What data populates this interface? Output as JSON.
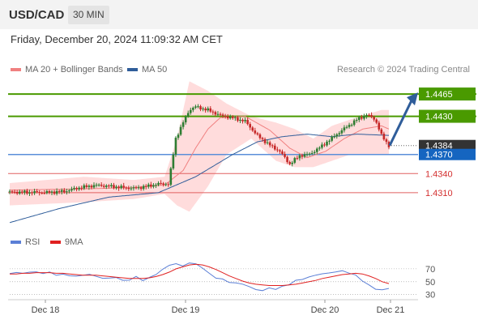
{
  "header": {
    "symbol": "USD/CAD",
    "timeframe": "30 MIN"
  },
  "datetime": "Friday, December 20, 2024 11:09:32 AM CET",
  "legend": [
    {
      "label": "MA 20 + Bollinger Bands",
      "color": "#f08080"
    },
    {
      "label": "MA 50",
      "color": "#2f5d9a"
    }
  ],
  "research_label": "Research © 2024 Trading Central",
  "colors": {
    "up": "#2e7d32",
    "down": "#c62828",
    "resistance": "#4a9a00",
    "support": "#e06060",
    "pivot": "#5b8fd9",
    "arrow": "#2f5d9a",
    "band": "#ffd6d6"
  },
  "chart_data": [
    {
      "type": "line",
      "title": "",
      "ylim": [
        1.425,
        1.4488
      ],
      "x_ticks": [
        "Dec 18",
        "Dec 19",
        "Dec 20",
        "Dec 21"
      ],
      "price_levels": [
        {
          "label": "1.4465",
          "value": 1.4465,
          "kind": "resistance"
        },
        {
          "label": "1.4430",
          "value": 1.443,
          "kind": "resistance"
        },
        {
          "label": "1.4384",
          "value": 1.4384,
          "kind": "current"
        },
        {
          "label": "1.4370",
          "value": 1.437,
          "kind": "pivot"
        },
        {
          "label": "1.4340",
          "value": 1.434,
          "kind": "support"
        },
        {
          "label": "1.4310",
          "value": 1.431,
          "kind": "support"
        }
      ],
      "close_key": [
        [
          0,
          1.4311
        ],
        [
          30,
          1.4311
        ],
        [
          45,
          1.4313
        ],
        [
          55,
          1.4318
        ],
        [
          70,
          1.4322
        ],
        [
          80,
          1.432
        ],
        [
          90,
          1.4318
        ],
        [
          100,
          1.4316
        ],
        [
          110,
          1.4319
        ],
        [
          120,
          1.4323
        ],
        [
          128,
          1.4323
        ],
        [
          130,
          1.4345
        ],
        [
          134,
          1.4395
        ],
        [
          140,
          1.442
        ],
        [
          145,
          1.444
        ],
        [
          150,
          1.4445
        ],
        [
          160,
          1.444
        ],
        [
          170,
          1.4432
        ],
        [
          180,
          1.4428
        ],
        [
          190,
          1.4423
        ],
        [
          200,
          1.44
        ],
        [
          210,
          1.4385
        ],
        [
          218,
          1.4375
        ],
        [
          226,
          1.4355
        ],
        [
          234,
          1.4368
        ],
        [
          242,
          1.437
        ],
        [
          250,
          1.438
        ],
        [
          260,
          1.4395
        ],
        [
          270,
          1.441
        ],
        [
          280,
          1.4424
        ],
        [
          288,
          1.4432
        ],
        [
          295,
          1.4425
        ],
        [
          300,
          1.44
        ],
        [
          306,
          1.4384
        ]
      ],
      "ma20_key": [
        [
          0,
          1.4314
        ],
        [
          60,
          1.4316
        ],
        [
          100,
          1.4318
        ],
        [
          125,
          1.4322
        ],
        [
          140,
          1.4345
        ],
        [
          150,
          1.438
        ],
        [
          160,
          1.441
        ],
        [
          170,
          1.4428
        ],
        [
          190,
          1.443
        ],
        [
          210,
          1.4408
        ],
        [
          226,
          1.438
        ],
        [
          240,
          1.4365
        ],
        [
          255,
          1.4375
        ],
        [
          270,
          1.4395
        ],
        [
          285,
          1.441
        ],
        [
          300,
          1.4415
        ],
        [
          306,
          1.441
        ]
      ],
      "ma50_key": [
        [
          0,
          1.4263
        ],
        [
          40,
          1.4285
        ],
        [
          80,
          1.4303
        ],
        [
          120,
          1.431
        ],
        [
          150,
          1.4335
        ],
        [
          180,
          1.437
        ],
        [
          200,
          1.439
        ],
        [
          220,
          1.4398
        ],
        [
          240,
          1.4402
        ],
        [
          260,
          1.4398
        ],
        [
          280,
          1.4402
        ],
        [
          306,
          1.44
        ]
      ],
      "bb_upper_key": [
        [
          0,
          1.4325
        ],
        [
          60,
          1.4335
        ],
        [
          100,
          1.433
        ],
        [
          125,
          1.4335
        ],
        [
          135,
          1.4395
        ],
        [
          145,
          1.4485
        ],
        [
          160,
          1.447
        ],
        [
          175,
          1.445
        ],
        [
          195,
          1.443
        ],
        [
          215,
          1.442
        ],
        [
          230,
          1.441
        ],
        [
          245,
          1.4395
        ],
        [
          260,
          1.4415
        ],
        [
          275,
          1.4425
        ],
        [
          300,
          1.444
        ],
        [
          306,
          1.444
        ]
      ],
      "bb_lower_key": [
        [
          0,
          1.429
        ],
        [
          60,
          1.4295
        ],
        [
          100,
          1.43
        ],
        [
          125,
          1.4308
        ],
        [
          135,
          1.429
        ],
        [
          145,
          1.428
        ],
        [
          160,
          1.432
        ],
        [
          175,
          1.437
        ],
        [
          195,
          1.4395
        ],
        [
          215,
          1.436
        ],
        [
          230,
          1.435
        ],
        [
          245,
          1.435
        ],
        [
          260,
          1.436
        ],
        [
          275,
          1.437
        ],
        [
          300,
          1.437
        ],
        [
          306,
          1.437
        ]
      ],
      "forecast_arrow": {
        "from": 1.4384,
        "to": 1.4465
      }
    },
    {
      "type": "line",
      "title": "",
      "ylim": [
        22,
        90
      ],
      "y_ticks": [
        30,
        50,
        70
      ],
      "series": [
        {
          "name": "RSI",
          "color": "#5b7fd6",
          "values": [
            62,
            64,
            63,
            66,
            65,
            63,
            64,
            61,
            62,
            60,
            58,
            60,
            62,
            59,
            56,
            55,
            57,
            52,
            54,
            58,
            52,
            56,
            62,
            70,
            76,
            78,
            74,
            80,
            78,
            72,
            62,
            56,
            54,
            50,
            48,
            46,
            42,
            38,
            37,
            40,
            38,
            42,
            46,
            52,
            54,
            56,
            60,
            62,
            64,
            65,
            66,
            63,
            60,
            52,
            44,
            38,
            36,
            40
          ]
        },
        {
          "name": "9MA",
          "color": "#e02020",
          "values": [
            62,
            62,
            63,
            63,
            64,
            64,
            64,
            63,
            63,
            62,
            61,
            60,
            60,
            60,
            59,
            58,
            57,
            56,
            55,
            55,
            55,
            56,
            58,
            61,
            65,
            70,
            73,
            76,
            77,
            76,
            73,
            69,
            64,
            59,
            55,
            51,
            48,
            46,
            45,
            44,
            44,
            44,
            45,
            46,
            48,
            50,
            52,
            55,
            57,
            59,
            61,
            62,
            63,
            62,
            59,
            55,
            50,
            47
          ]
        }
      ]
    }
  ]
}
